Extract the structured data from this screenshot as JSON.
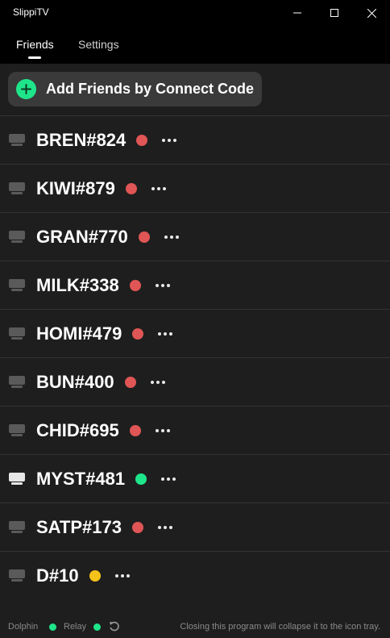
{
  "window": {
    "title": "SlippiTV",
    "controls": [
      "minimize-icon",
      "maximize-icon",
      "close-icon"
    ]
  },
  "tabs": [
    {
      "label": "Friends",
      "active": true
    },
    {
      "label": "Settings",
      "active": false
    }
  ],
  "add_friend": {
    "label": "Add Friends by Connect Code",
    "icon": "plus-icon",
    "icon_color": "#1fe58a"
  },
  "colors": {
    "offline": "#e05555",
    "online": "#1fe58a",
    "idle": "#f5c21b"
  },
  "friends": [
    {
      "code": "BREN#824",
      "status": "offline",
      "device_active": false
    },
    {
      "code": "KIWI#879",
      "status": "offline",
      "device_active": false
    },
    {
      "code": "GRAN#770",
      "status": "offline",
      "device_active": false
    },
    {
      "code": "MILK#338",
      "status": "offline",
      "device_active": false
    },
    {
      "code": "HOMI#479",
      "status": "offline",
      "device_active": false
    },
    {
      "code": "BUN#400",
      "status": "offline",
      "device_active": false
    },
    {
      "code": "CHID#695",
      "status": "offline",
      "device_active": false
    },
    {
      "code": "MYST#481",
      "status": "online",
      "device_active": true
    },
    {
      "code": "SATP#173",
      "status": "offline",
      "device_active": false
    },
    {
      "code": "D#10",
      "status": "idle",
      "device_active": false
    }
  ],
  "footer": {
    "dolphin_label": "Dolphin",
    "relay_label": "Relay",
    "dolphin_status": "online",
    "relay_status": "online",
    "refresh_icon": "refresh-icon",
    "note": "Closing this program will collapse it to the icon tray."
  }
}
